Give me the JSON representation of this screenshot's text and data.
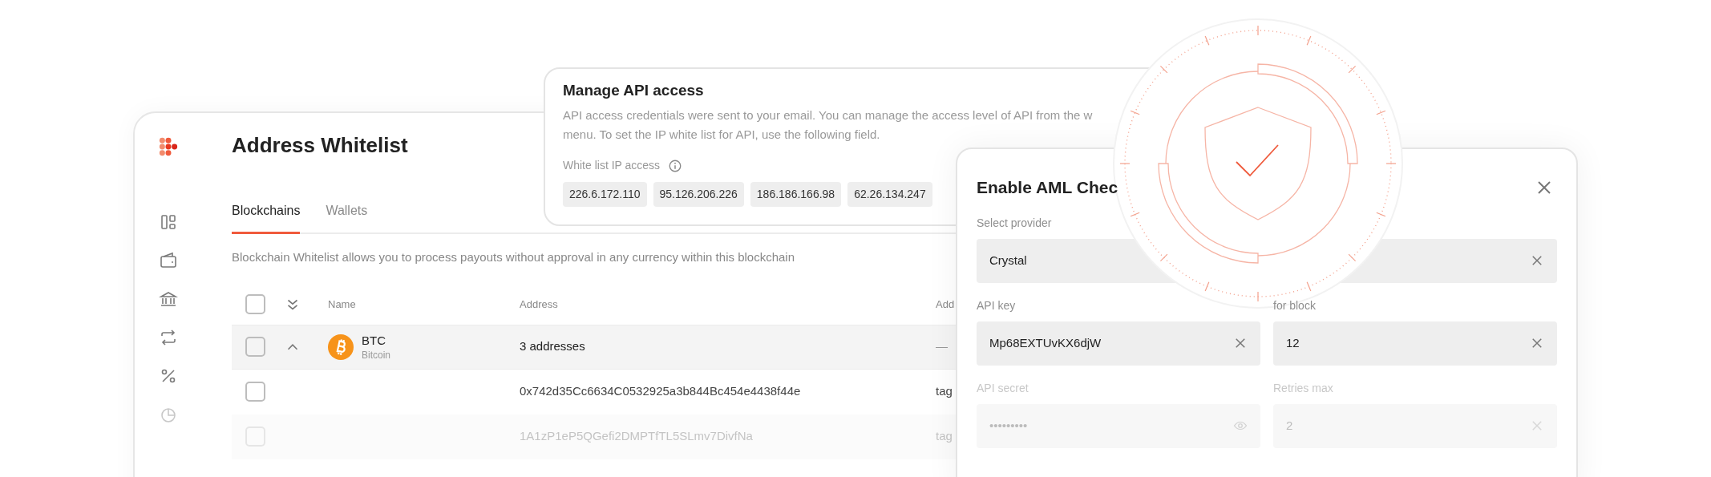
{
  "main": {
    "title": "Address Whitelist",
    "tabs": [
      {
        "label": "Blockchains",
        "selected": true
      },
      {
        "label": "Wallets",
        "selected": false
      }
    ],
    "description": "Blockchain Whitelist allows you to process payouts without approval in any currency within this blockchain",
    "table": {
      "header_checked": false,
      "columns": [
        "Name",
        "Address",
        "Add"
      ],
      "rows": [
        {
          "kind": "group",
          "checked": false,
          "expanded": true,
          "name": "BTC",
          "subtitle": "Bitcoin",
          "address": "3 addresses",
          "column_3": "—",
          "faded": false
        },
        {
          "kind": "address",
          "checked": false,
          "address": "0x742d35Cc6634C0532925a3b844Bc454e4438f44e",
          "column_3": "tag",
          "faded": false
        },
        {
          "kind": "address",
          "checked": false,
          "address": "1A1zP1eP5QGefi2DMPTfTL5SLmv7DivfNa",
          "column_3": "tag",
          "faded": true
        }
      ]
    }
  },
  "api_card": {
    "title": "Manage API access",
    "description_lines": [
      "API access credentials were sent to your email. You can manage the access level of API from the w",
      "menu. To set the IP white list for API, use the following field."
    ],
    "ip_label": "White list IP access",
    "ips": [
      "226.6.172.110",
      "95.126.206.226",
      "186.186.166.98",
      "62.26.134.247"
    ]
  },
  "aml_modal": {
    "title": "Enable AML Chec",
    "fields": [
      {
        "kind": "select",
        "label": "Select provider",
        "value": "Crystal",
        "faded": false
      },
      {
        "kind": "text",
        "label": "API key",
        "value": "Mp68EXTUvKX6djW",
        "faded": false
      },
      {
        "kind": "text",
        "label": "for block",
        "value": "12",
        "faded": false
      },
      {
        "kind": "secret",
        "label": "API secret",
        "value": "•••••••••",
        "faded": true
      },
      {
        "kind": "text",
        "label": "Retries max",
        "value": "2",
        "faded": true
      }
    ]
  }
}
